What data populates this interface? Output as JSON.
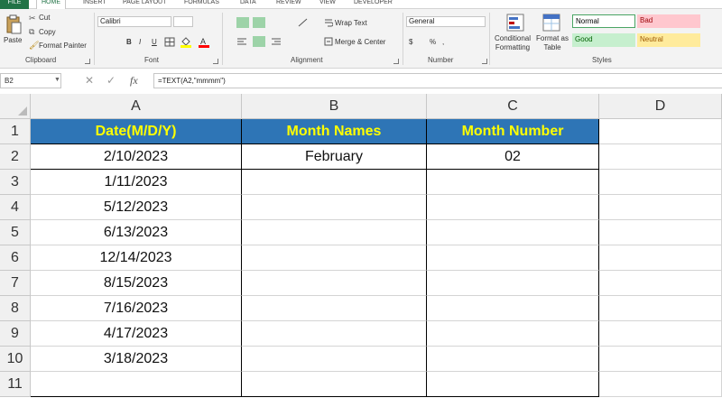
{
  "tabs": [
    "FILE",
    "HOME",
    "INSERT",
    "PAGE LAYOUT",
    "FORMULAS",
    "DATA",
    "REVIEW",
    "VIEW",
    "DEVELOPER"
  ],
  "ribbon": {
    "clipboard": {
      "paste": "Paste",
      "cut": "Cut",
      "copy": "Copy",
      "format_painter": "Format Painter",
      "label": "Clipboard"
    },
    "font": {
      "name": "Calibri",
      "label": "Font",
      "bold": "B",
      "italic": "I",
      "underline": "U"
    },
    "alignment": {
      "wrap_text": "Wrap Text",
      "merge_center": "Merge & Center",
      "label": "Alignment"
    },
    "number": {
      "format": "General",
      "currency": "$",
      "percent": "%",
      "comma": ",",
      "label": "Number"
    },
    "conditional_formatting": "Conditional Formatting",
    "format_as_table": "Format as Table",
    "styles": {
      "normal": "Normal",
      "bad": "Bad",
      "good": "Good",
      "neutral": "Neutral",
      "label": "Styles"
    }
  },
  "formula_bar": {
    "name_box": "B2",
    "fx": "fx",
    "formula": "=TEXT(A2,\"mmmm\")"
  },
  "colors": {
    "header_fill": "#2e75b6",
    "header_text": "#ffff00",
    "excel_green": "#217346"
  },
  "columns": [
    "A",
    "B",
    "C",
    "D"
  ],
  "rows": [
    "1",
    "2",
    "3",
    "4",
    "5",
    "6",
    "7",
    "8",
    "9",
    "10",
    "11"
  ],
  "table": {
    "headers": [
      "Date(M/D/Y)",
      "Month Names",
      "Month Number"
    ],
    "dates": [
      "2/10/2023",
      "1/11/2023",
      "5/12/2023",
      "6/13/2023",
      "12/14/2023",
      "8/15/2023",
      "7/16/2023",
      "4/17/2023",
      "3/18/2023"
    ],
    "month_names": [
      "February"
    ],
    "month_numbers": [
      "02"
    ]
  }
}
